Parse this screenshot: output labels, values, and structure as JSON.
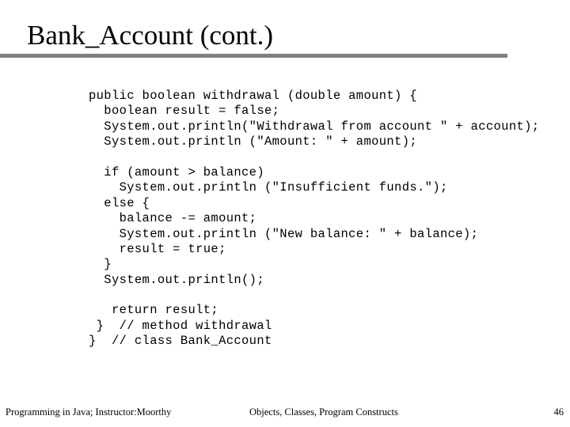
{
  "slide": {
    "title": "Bank_Account (cont.)",
    "rule_color": "#808080",
    "background_color": "#ffffff",
    "text_color": "#000000"
  },
  "code": {
    "language": "java",
    "lines": [
      "public boolean withdrawal (double amount) {",
      "  boolean result = false;",
      "  System.out.println(\"Withdrawal from account \" + account);",
      "  System.out.println (\"Amount: \" + amount);",
      "",
      "  if (amount > balance)",
      "    System.out.println (\"Insufficient funds.\");",
      "  else {",
      "    balance -= amount;",
      "    System.out.println (\"New balance: \" + balance);",
      "    result = true;",
      "  }",
      "  System.out.println();",
      "",
      "   return result;",
      " }  // method withdrawal",
      "}  // class Bank_Account"
    ]
  },
  "footer": {
    "left": "Programming in Java; Instructor:Moorthy",
    "center": "Objects, Classes, Program Constructs",
    "page_number": "46"
  }
}
